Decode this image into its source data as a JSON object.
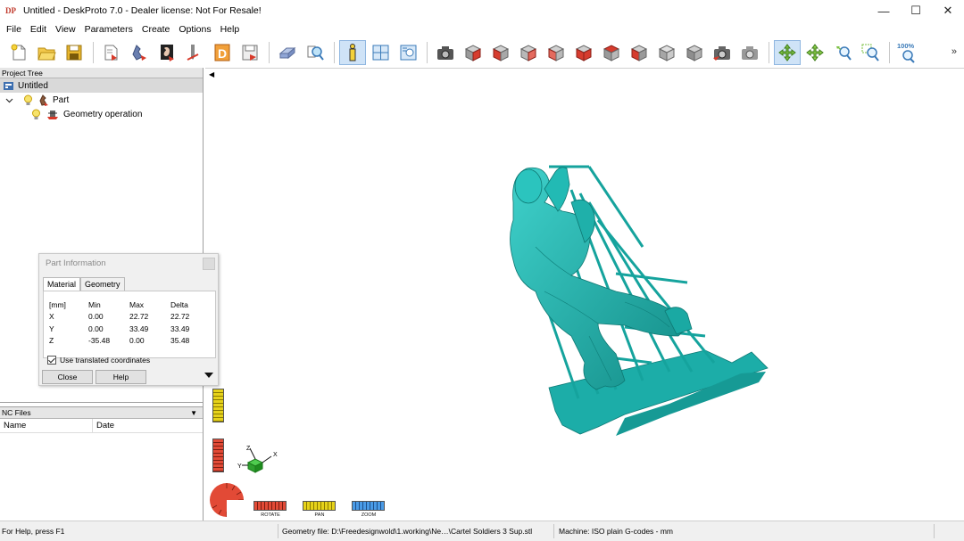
{
  "window": {
    "title": "Untitled - DeskProto 7.0 - Dealer license: Not For Resale!",
    "logo_text": "DP",
    "minimize": "—",
    "maximize": "☐",
    "close": "✕"
  },
  "menu": [
    "File",
    "Edit",
    "View",
    "Parameters",
    "Create",
    "Options",
    "Help"
  ],
  "toolbar": {
    "zoom_level": "100%",
    "overflow": "»"
  },
  "project_tree": {
    "header": "Project Tree",
    "root": "Untitled",
    "part": "Part",
    "operation": "Geometry operation"
  },
  "nc_files": {
    "header": "NC Files",
    "columns": [
      "Name",
      "Date"
    ]
  },
  "part_info": {
    "title": "Part Information",
    "tabs": [
      "Material",
      "Geometry"
    ],
    "columns": [
      "[mm]",
      "Min",
      "Max",
      "Delta"
    ],
    "rows": [
      [
        "X",
        "0.00",
        "22.72",
        "22.72"
      ],
      [
        "Y",
        "0.00",
        "33.49",
        "33.49"
      ],
      [
        "Z",
        "-35.48",
        "0.00",
        "35.48"
      ]
    ],
    "checkbox_label": "Use translated coordinates",
    "close_button": "Close",
    "help_button": "Help"
  },
  "viewport": {
    "nav_rotate": "ROTATE",
    "nav_pan": "PAN",
    "nav_zoom": "ZOOM",
    "axis_x": "X",
    "axis_y": "Y",
    "axis_z": "Z",
    "model_color": "#1fb3ad"
  },
  "status": {
    "help": "For Help, press F1",
    "geometry_file": "Geometry file: D:\\Freedesignwold\\1.working\\Ne…\\Cartel Soldiers 3 Sup.stl",
    "machine": "Machine: ISO plain G-codes - mm"
  }
}
